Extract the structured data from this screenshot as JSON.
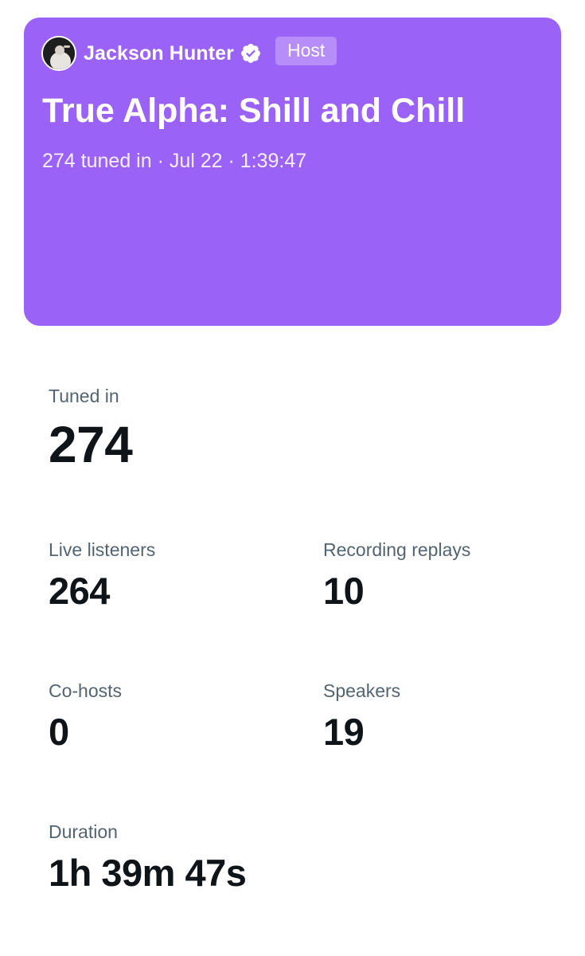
{
  "space": {
    "host_name": "Jackson Hunter",
    "host_badge": "Host",
    "title": "True Alpha: Shill and Chill",
    "meta": "274 tuned in · Jul 22 · 1:39:47",
    "card_color": "#9b62f8"
  },
  "stats": {
    "tuned_in": {
      "label": "Tuned in",
      "value": "274"
    },
    "live_listeners": {
      "label": "Live listeners",
      "value": "264"
    },
    "recording_replays": {
      "label": "Recording replays",
      "value": "10"
    },
    "co_hosts": {
      "label": "Co-hosts",
      "value": "0"
    },
    "speakers": {
      "label": "Speakers",
      "value": "19"
    },
    "duration": {
      "label": "Duration",
      "value": "1h 39m 47s"
    }
  },
  "icons": {
    "avatar": "avatar",
    "verified": "verified-badge-icon"
  }
}
